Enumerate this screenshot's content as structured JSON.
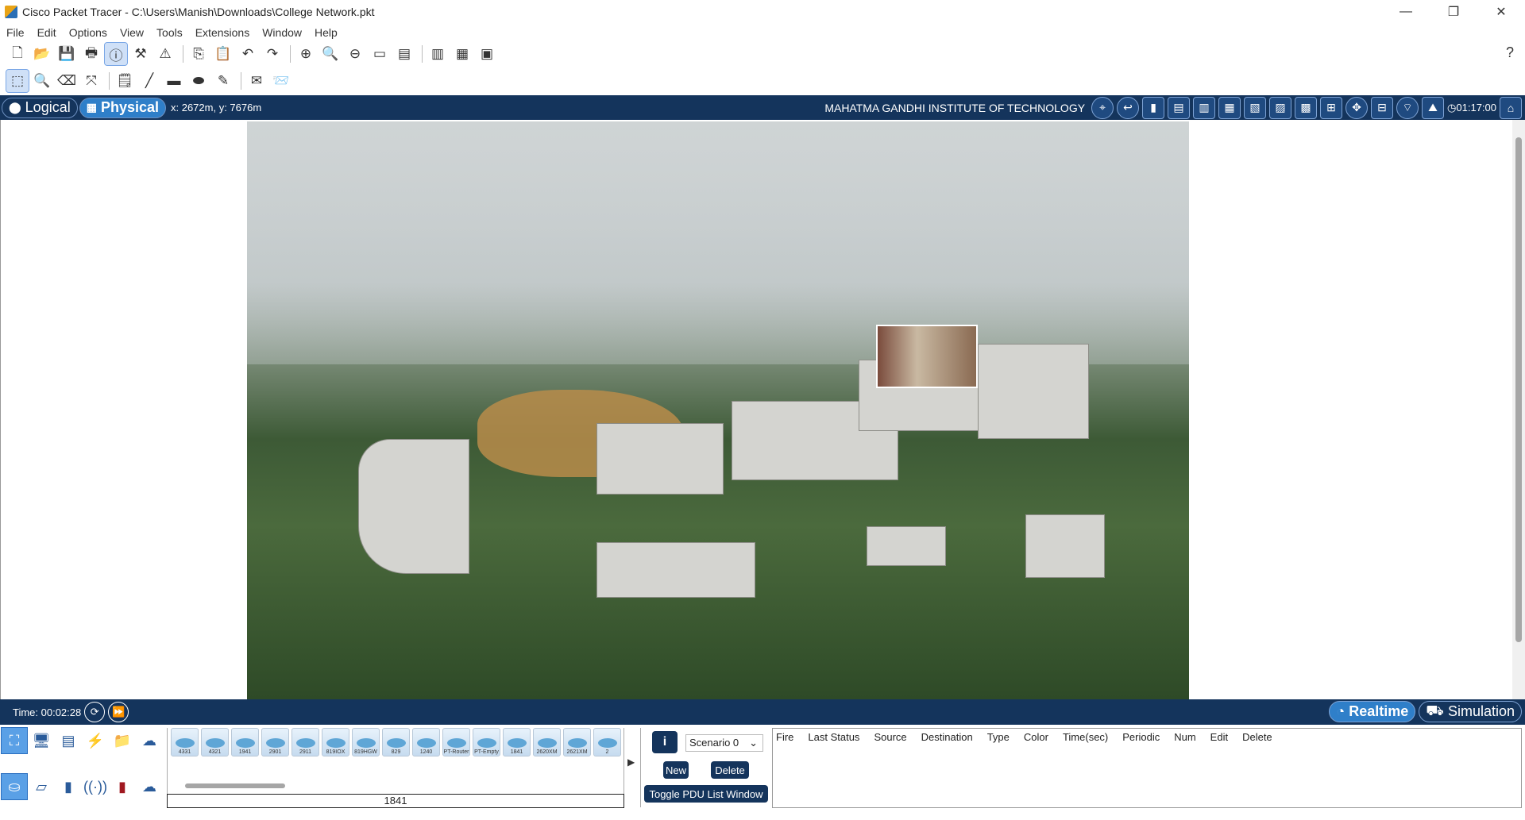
{
  "window": {
    "title": "Cisco Packet Tracer - C:\\Users\\Manish\\Downloads\\College Network.pkt",
    "minimize": "—",
    "restore": "❐",
    "close": "✕"
  },
  "menu": [
    "File",
    "Edit",
    "Options",
    "View",
    "Tools",
    "Extensions",
    "Window",
    "Help"
  ],
  "toolbar": {
    "help": "?"
  },
  "nav": {
    "logical": "Logical",
    "physical": "Physical",
    "coords": "x: 2672m, y: 7676m",
    "location": "MAHATMA GANDHI INSTITUTE OF TECHNOLOGY",
    "clock": "01:17:00"
  },
  "timebar": {
    "time": "Time: 00:02:28",
    "realtime": "Realtime",
    "simulation": "Simulation"
  },
  "devices": {
    "items": [
      "4331",
      "4321",
      "1941",
      "2901",
      "2911",
      "819IOX",
      "819HGW",
      "829",
      "1240",
      "PT-Router",
      "PT-Empty",
      "1841",
      "2620XM",
      "2621XM",
      "2"
    ],
    "selected": "1841"
  },
  "scenario": {
    "info": "i",
    "name": "Scenario 0",
    "new": "New",
    "delete": "Delete",
    "toggle": "Toggle PDU List Window"
  },
  "pdu_columns": [
    "Fire",
    "Last Status",
    "Source",
    "Destination",
    "Type",
    "Color",
    "Time(sec)",
    "Periodic",
    "Num",
    "Edit",
    "Delete"
  ]
}
